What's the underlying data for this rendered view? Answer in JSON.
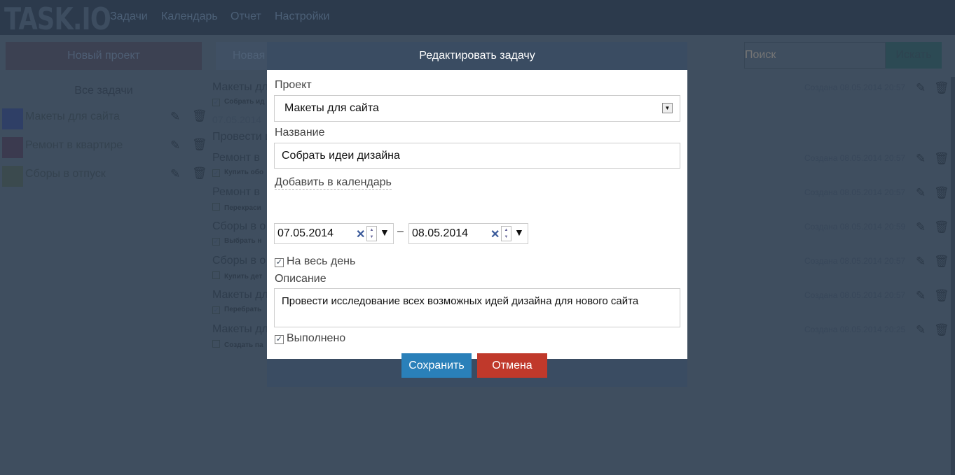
{
  "header": {
    "logo": "TASK.IO",
    "nav": [
      "Задачи",
      "Календарь",
      "Отчет",
      "Настройки"
    ]
  },
  "toolbar": {
    "new_project": "Новый проект",
    "new_task": "Новая",
    "search_placeholder": "Поиск",
    "search_button": "Искать"
  },
  "sidebar": {
    "all_tasks": "Все задачи",
    "projects": [
      {
        "name": "Макеты для сайта",
        "color": "#2f3f66"
      },
      {
        "name": "Ремонт в квартире",
        "color": "#3b3a4f"
      },
      {
        "name": "Сборы в отпуск",
        "color": "#3b4a4e"
      }
    ]
  },
  "tasks": {
    "groups": [
      {
        "project": "Макеты дл",
        "task": "Собрать ид",
        "done": true,
        "created": "Создана 08.05.2014 20:57",
        "date": "07.05.2014",
        "desc": "Провести и"
      },
      {
        "project": "Ремонт в",
        "task": "Купить обо",
        "done": true,
        "created": "Создана 08.05.2014 20:57"
      },
      {
        "project": "Ремонт в",
        "task": "Перекраси",
        "done": false,
        "created": "Создана 08.05.2014 20:57"
      },
      {
        "project": "Сборы в о",
        "task": "Выбрать н",
        "done": true,
        "created": "Создана 08.05.2014 20:59"
      },
      {
        "project": "Сборы в о",
        "task": "Купить дет",
        "done": false,
        "created": "Создана 08.05.2014 20:57"
      },
      {
        "project": "Макеты дл",
        "task": "Перебрать",
        "done": true,
        "created": "Создана 08.05.2014 20:57"
      },
      {
        "project": "Макеты дл",
        "task": "Создать па",
        "done": false,
        "created": "Создана 08.05.2014 20:25"
      }
    ]
  },
  "modal": {
    "title": "Редактировать задачу",
    "project_label": "Проект",
    "project_value": "Макеты для сайта",
    "name_label": "Название",
    "name_value": "Собрать идеи дизайна",
    "calendar_label": "Добавить в календарь",
    "date_from": "07.05.2014",
    "date_to": "08.05.2014",
    "dash": "–",
    "all_day_label": "На весь день",
    "all_day": true,
    "description_label": "Описание",
    "description_value": "Провести исследование всех возможных идей дизайна для нового сайта",
    "done_label": "Выполнено",
    "done": true,
    "save": "Сохранить",
    "cancel": "Отмена"
  },
  "colors": {
    "save": "#2a80b9",
    "cancel": "#c0392b",
    "modal_header": "#3a4c62"
  }
}
